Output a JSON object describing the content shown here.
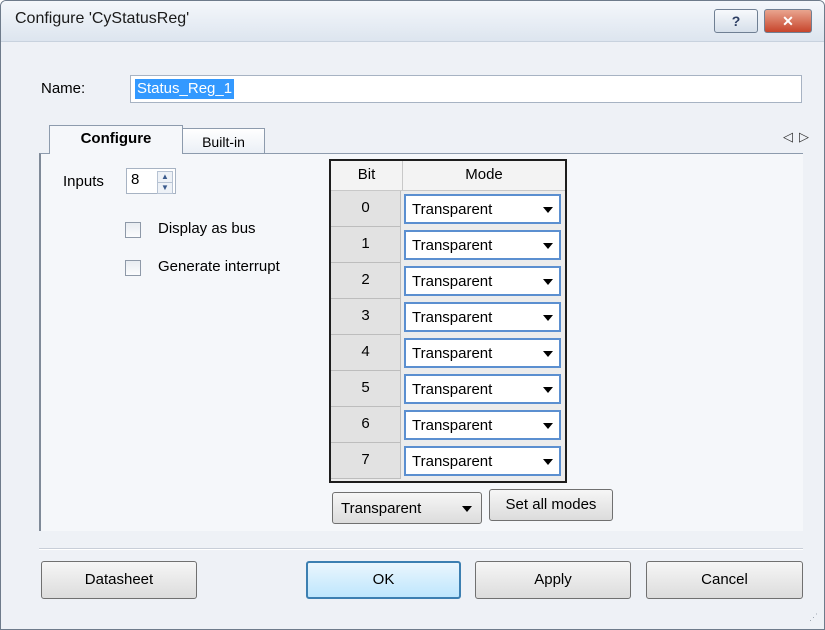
{
  "window": {
    "title": "Configure 'CyStatusReg'",
    "help_label": "?",
    "close_label": "✕"
  },
  "name": {
    "label": "Name:",
    "value": "Status_Reg_1"
  },
  "tabs": [
    {
      "label": "Configure",
      "active": true
    },
    {
      "label": "Built-in",
      "active": false
    }
  ],
  "tab_nav": {
    "prev_icon": "◁",
    "next_icon": "▷"
  },
  "configure": {
    "inputs_label": "Inputs",
    "inputs_value": "8",
    "display_as_bus": {
      "label": "Display as bus",
      "checked": false
    },
    "generate_interrupt": {
      "label": "Generate interrupt",
      "checked": false
    }
  },
  "grid": {
    "headers": {
      "bit": "Bit",
      "mode": "Mode"
    },
    "rows": [
      {
        "bit": "0",
        "mode": "Transparent"
      },
      {
        "bit": "1",
        "mode": "Transparent"
      },
      {
        "bit": "2",
        "mode": "Transparent"
      },
      {
        "bit": "3",
        "mode": "Transparent"
      },
      {
        "bit": "4",
        "mode": "Transparent"
      },
      {
        "bit": "5",
        "mode": "Transparent"
      },
      {
        "bit": "6",
        "mode": "Transparent"
      },
      {
        "bit": "7",
        "mode": "Transparent"
      }
    ]
  },
  "set_all": {
    "select_value": "Transparent",
    "button_label": "Set all modes"
  },
  "footer": {
    "datasheet": "Datasheet",
    "ok": "OK",
    "apply": "Apply",
    "cancel": "Cancel"
  }
}
